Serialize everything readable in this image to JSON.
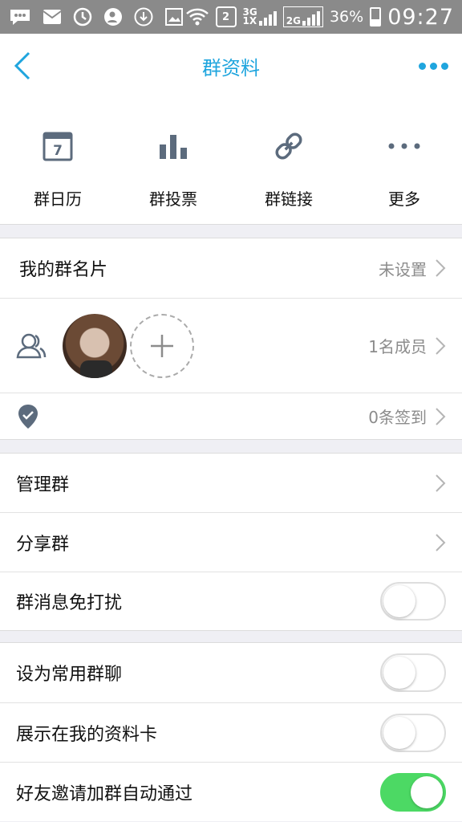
{
  "status_bar": {
    "network_labels": [
      "3G",
      "1X",
      "2G"
    ],
    "sim_badge": "2",
    "battery": "36%",
    "time": "09:27",
    "icons": [
      "message-icon",
      "mail-icon",
      "sync-icon",
      "user-plus-icon",
      "download-icon",
      "image-icon",
      "wifi-icon"
    ]
  },
  "nav": {
    "title": "群资料",
    "accent_color": "#1fa5de"
  },
  "tools": [
    {
      "label": "群日历",
      "icon": "calendar-icon",
      "badge": "7"
    },
    {
      "label": "群投票",
      "icon": "bar-chart-icon"
    },
    {
      "label": "群链接",
      "icon": "link-icon"
    },
    {
      "label": "更多",
      "icon": "more-icon"
    }
  ],
  "group_card": {
    "label": "我的群名片",
    "value": "未设置"
  },
  "members": {
    "value": "1名成员",
    "icon": "members-icon"
  },
  "checkin": {
    "value": "0条签到",
    "icon": "location-pin-icon"
  },
  "manage": {
    "manage_label": "管理群",
    "share_label": "分享群",
    "mute_label": "群消息免打扰",
    "mute_on": false
  },
  "prefs": {
    "favorite_label": "设为常用群聊",
    "favorite_on": false,
    "show_card_label": "展示在我的资料卡",
    "show_card_on": false,
    "auto_approve_label": "好友邀请加群自动通过",
    "auto_approve_on": true,
    "toggle_on_color": "#4cd964"
  }
}
